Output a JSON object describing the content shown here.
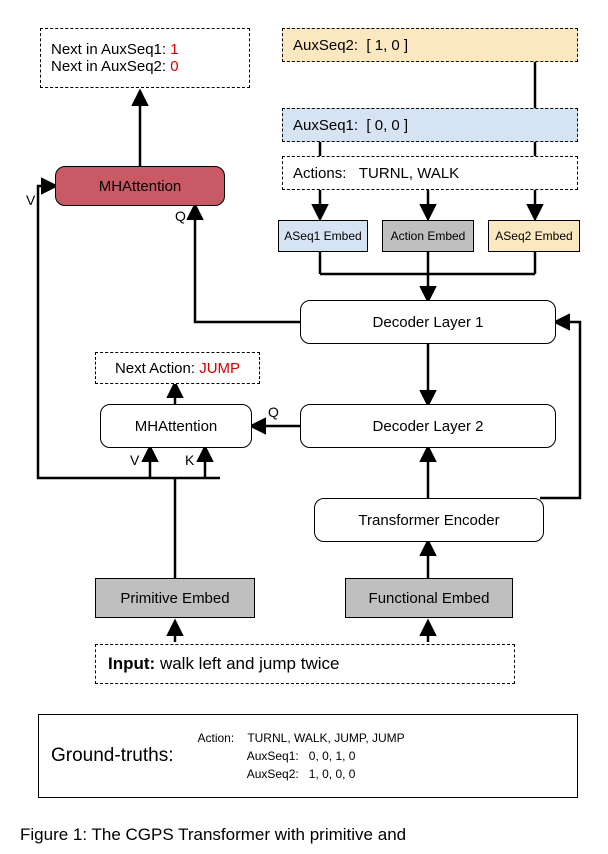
{
  "top_predictions": {
    "line1_label": "Next in AuxSeq1:",
    "line1_val": "1",
    "line2_label": "Next in AuxSeq2:",
    "line2_val": "0"
  },
  "auxseq2_box": {
    "prefix": "AuxSeq2:",
    "content": "[  1,           0  ]"
  },
  "auxseq1_box": {
    "prefix": "AuxSeq1:",
    "content": "[  0,           0  ]"
  },
  "actions_box": {
    "prefix": "Actions:",
    "content": "TURNL, WALK"
  },
  "mha1": "MHAttention",
  "mha2": "MHAttention",
  "aseq1_embed": "ASeq1 Embed",
  "action_embed": "Action Embed",
  "aseq2_embed": "ASeq2 Embed",
  "dec1": "Decoder Layer 1",
  "dec2": "Decoder Layer 2",
  "next_action_label": "Next Action:",
  "next_action_val": "JUMP",
  "enc": "Transformer Encoder",
  "prim_embed": "Primitive Embed",
  "func_embed": "Functional Embed",
  "input_label": "Input:",
  "input_text": "walk left and jump twice",
  "ground_truths_label": "Ground-truths:",
  "gt": {
    "action_label": "Action:",
    "action_vals": "TURNL,  WALK,  JUMP,  JUMP",
    "aux1_label": "AuxSeq1:",
    "aux1_vals": "0,           0,         1,          0",
    "aux2_label": "AuxSeq2:",
    "aux2_vals": "1,           0,         0,          0"
  },
  "caption": "Figure 1:  The CGPS Transformer with primitive and",
  "labels": {
    "V": "V",
    "K": "K",
    "Q": "Q"
  }
}
